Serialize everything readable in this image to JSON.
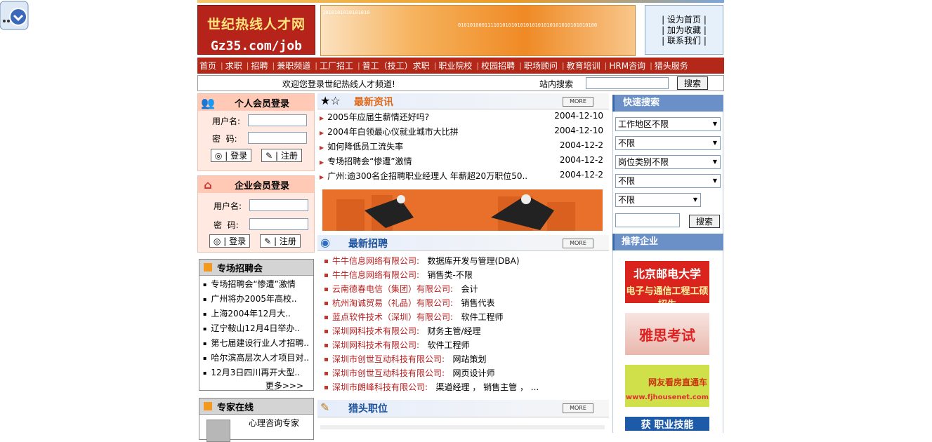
{
  "header": {
    "logo_line1": "世纪热线人才网",
    "logo_line2": "Gz35.com/job",
    "banner_binary_1": "1010101010101010",
    "banner_binary_2": "01010100011110101010101010101010101010101010100",
    "links": [
      "| 设为首页 |",
      "| 加为收藏 |",
      "| 联系我们 |"
    ]
  },
  "nav": [
    "首页",
    "求职",
    "招聘",
    "兼职频道",
    "工厂招工",
    "普工（技工）求职",
    "职业院校",
    "校园招聘",
    "职场顾问",
    "教育培训",
    "HRM咨询",
    "猎头服务"
  ],
  "welcome_bar": {
    "welcome": "欢迎您登录世纪热线人才频道!",
    "search_label": "站内搜索",
    "search_button": "搜索"
  },
  "personal_login": {
    "title": "个人会员登录",
    "username_label": "用户名:",
    "password_label": "密  码:",
    "login_button": "◎ | 登录",
    "register_button": "✎ | 注册"
  },
  "company_login": {
    "title": "企业会员登录",
    "username_label": "用户名:",
    "password_label": "密  码:",
    "login_button": "◎ | 登录",
    "register_button": "✎ | 注册"
  },
  "job_fair": {
    "title": "专场招聘会",
    "items": [
      "专场招聘会“惨遭”激情",
      "广州将办2005年高校..",
      "上海2004年12月大..",
      "辽宁鞍山12月4日举办..",
      "第七届建设行业人才招聘..",
      "哈尔滨高层次人才项目对..",
      "12月3日四川再开大型.."
    ],
    "more": "更多>>>"
  },
  "expert": {
    "title": "专家在线",
    "name": "心理咨询专家"
  },
  "latest_news": {
    "title": "最新资讯",
    "more": "MORE",
    "items": [
      {
        "title": "2005年应届生薪情还好吗?",
        "date": "2004-12-10"
      },
      {
        "title": "2004年白领最心仪就业城市大比拼",
        "date": "2004-12-10"
      },
      {
        "title": "如何降低员工流失率",
        "date": "2004-12-2"
      },
      {
        "title": "专场招聘会“惨遭”激情",
        "date": "2004-12-2"
      },
      {
        "title": "广州:逾300名企招聘职业经理人 年薪超20万职位50..",
        "date": "2004-12-2"
      }
    ]
  },
  "latest_jobs": {
    "title": "最新招聘",
    "more": "MORE",
    "items": [
      {
        "company": "牛牛信息网络有限公司:",
        "position": "数据库开发与管理(DBA)"
      },
      {
        "company": "牛牛信息网络有限公司:",
        "position": "销售类-不限"
      },
      {
        "company": "云南德春电信（集团）有限公司:",
        "position": "会计"
      },
      {
        "company": "杭州淘诚贸易（礼品）有限公司:",
        "position": "销售代表"
      },
      {
        "company": "蓝点软件技术（深圳）有限公司:",
        "position": "软件工程师"
      },
      {
        "company": "深圳网科技术有限公司:",
        "position": "财务主管/经理"
      },
      {
        "company": "深圳网科技术有限公司:",
        "position": "软件工程师"
      },
      {
        "company": "深圳市创世互动科技有限公司:",
        "position": "网站策划"
      },
      {
        "company": "深圳市创世互动科技有限公司:",
        "position": "网页设计师"
      },
      {
        "company": "深圳市朗峰科技有限公司:",
        "position": "渠道经理 ， 销售主管 ， ..."
      }
    ]
  },
  "headhunter": {
    "title": "猎头职位",
    "more": "MORE"
  },
  "quick_search": {
    "title": "快速搜索",
    "selects": [
      "工作地区不限",
      "不限",
      "岗位类别不限",
      "不限",
      "不限"
    ],
    "button": "搜索"
  },
  "recommended": {
    "title": "推荐企业",
    "ads": [
      {
        "line1": "北京邮电大学",
        "line2": "电子与通信工程工硕招生",
        "bg": "#d9231c"
      },
      {
        "line1": "雅思考试",
        "line2": "",
        "bg": "#f3d6d0"
      },
      {
        "line1": "网友看房直通车",
        "line2": "www.fjhousenet.com",
        "bg": "#cfe04a"
      },
      {
        "line1": "获 职业技能",
        "line2": "",
        "bg": "#1d5aa8"
      }
    ]
  }
}
